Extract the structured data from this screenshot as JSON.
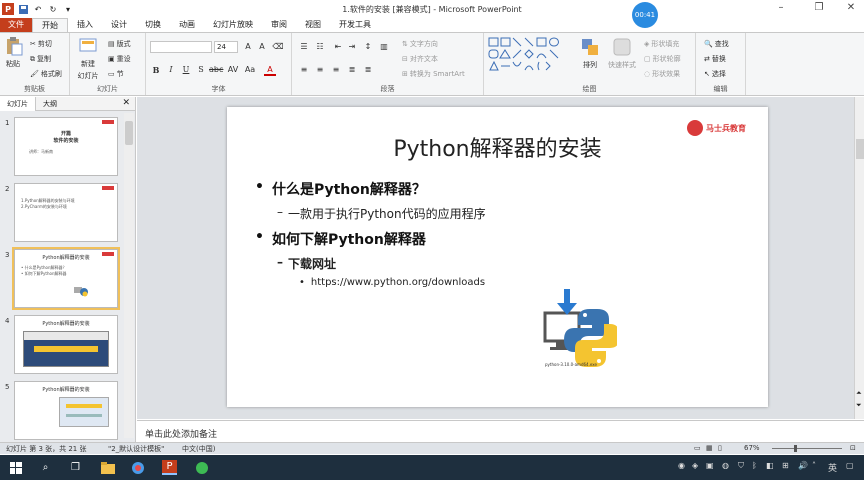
{
  "window": {
    "title": "1.软件的安装 [兼容模式] - Microsoft PowerPoint",
    "timer": "00:41"
  },
  "tabs": [
    "文件",
    "开始",
    "插入",
    "设计",
    "切换",
    "动画",
    "幻灯片放映",
    "审阅",
    "视图",
    "开发工具"
  ],
  "ribbon": {
    "clipboard": {
      "paste": "粘贴",
      "cut": "剪切",
      "copy": "复制",
      "format_painter": "格式刷",
      "label": "剪贴板"
    },
    "slides": {
      "new_slide": "新建",
      "new_slide2": "幻灯片",
      "layout": "版式",
      "reset": "重设",
      "section": "节",
      "label": "幻灯片"
    },
    "font": {
      "size": "24",
      "label": "字体"
    },
    "paragraph": {
      "text_direction": "文字方向",
      "align_text": "对齐文本",
      "smartart": "转换为 SmartArt",
      "label": "段落"
    },
    "drawing": {
      "arrange": "排列",
      "quick_styles": "快速样式",
      "shape_fill": "形状填充",
      "shape_outline": "形状轮廓",
      "shape_effects": "形状效果",
      "label": "绘图"
    },
    "editing": {
      "find": "查找",
      "replace": "替换",
      "select": "选择",
      "label": "编辑"
    }
  },
  "left_panel": {
    "tabs": [
      "幻灯片",
      "大纲"
    ],
    "thumbs": [
      {
        "num": "1",
        "title": "开篇",
        "subtitle": "软件的安装",
        "line": "讲师：马新南"
      },
      {
        "num": "2",
        "line1": "1.Python解释器的安装与环境",
        "line2": "2.PyCharm的安装与环境"
      },
      {
        "num": "3",
        "title": "Python解释器的安装",
        "line1": "• 什么是Python解释器？",
        "line2": "• 如何下解Python解释器"
      },
      {
        "num": "4",
        "title": "Python解释器的安装"
      },
      {
        "num": "5",
        "title": "Python解释器的安装"
      }
    ]
  },
  "slide": {
    "title": "Python解释器的安装",
    "logo": "马士兵教育",
    "b1": "什么是Python解释器？",
    "b1_sub": "一款用于执行Python代码的应用程序",
    "b2": "如何下解Python解释器",
    "b2_sub": "下载网址",
    "b2_url": "https://www.python.org/downloads",
    "caption": "python-3.10.0-amd64.exe",
    "bullet": "•",
    "dash": "–"
  },
  "notes_placeholder": "单击此处添加备注",
  "status": {
    "slide_info": "幻灯片 第 3 张，共 21 张",
    "theme": "\"2_默认设计模板\"",
    "language": "中文(中国)",
    "zoom": "67%"
  },
  "taskbar": {
    "ime": "英",
    "tray_icons": [
      "network-icon",
      "volume-icon",
      "bluetooth-icon"
    ]
  }
}
